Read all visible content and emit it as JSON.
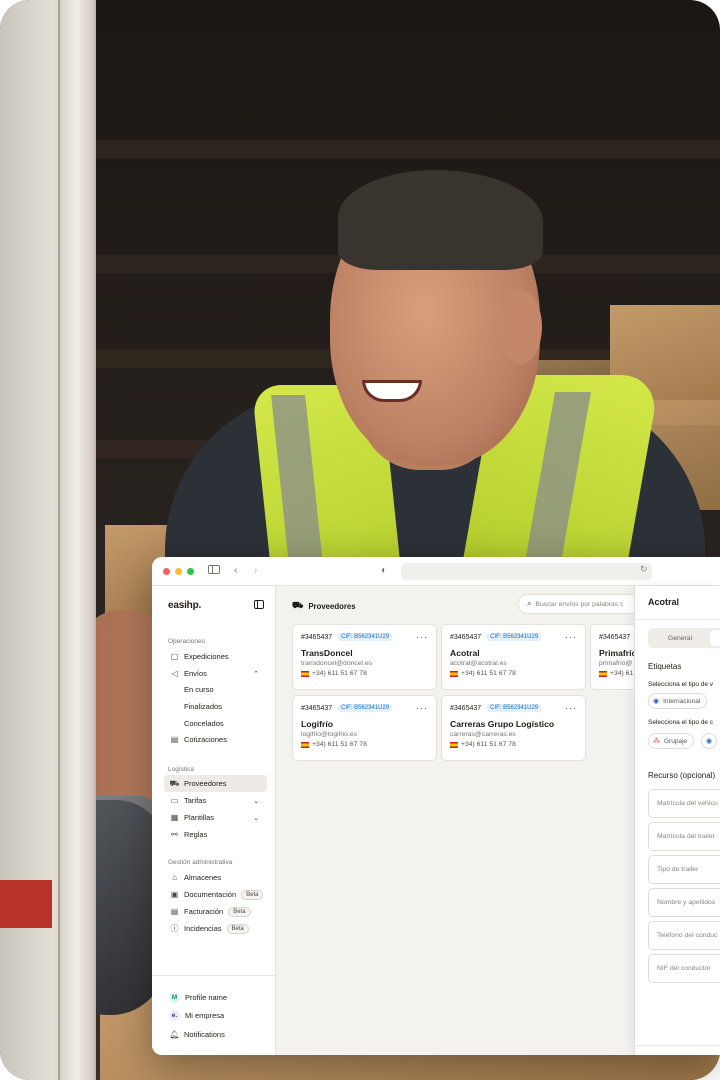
{
  "window": {
    "title": ""
  },
  "sidebar": {
    "logo": "easihp.",
    "sections": {
      "operaciones": "Operaciones",
      "logistica": "Logística",
      "gestion": "Gestión administrativa"
    },
    "items": {
      "expediciones": "Expediciones",
      "envios": "Envíos",
      "en_curso": "En curso",
      "finalizados": "Finalizados",
      "concelados": "Concelados",
      "cotizaciones": "Cotizaciones",
      "proveedores": "Proveedores",
      "tarifas": "Tarifas",
      "plantillas": "Plantillas",
      "reglas": "Reglas",
      "almacenes": "Almacenes",
      "documentacion": "Documentación",
      "facturacion": "Facturación",
      "incidencias": "Incidencias"
    },
    "badge_beta": "Beta",
    "footer": {
      "profile": "Profile name",
      "profile_initial": "M",
      "company": "Mi empresa",
      "company_initial": "e.",
      "notifications": "Notifications"
    }
  },
  "main": {
    "title": "Proveedores",
    "search_placeholder": "Buscar envíos por palabras c",
    "cards": [
      {
        "id": "#3465437",
        "cif": "CIF: B562341U29",
        "name": "TransDoncel",
        "email": "transdoncel@doncel.es",
        "phone": "+34) 611 51 67 78"
      },
      {
        "id": "#3465437",
        "cif": "CIF: B562341U29",
        "name": "Acotral",
        "email": "acotral@acotral.es",
        "phone": "+34) 611 51 67 78"
      },
      {
        "id": "#3465437",
        "cif": "CIF: B562341U29",
        "name": "Primafrío",
        "email": "primafrio@",
        "phone": "+34) 61"
      },
      {
        "id": "#3465437",
        "cif": "CIF: B562341U29",
        "name": "Logifrío",
        "email": "logifrio@logifrio.es",
        "phone": "+34) 611 51 67 78"
      },
      {
        "id": "#3465437",
        "cif": "CIF: B562341U29",
        "name": "Carreras Grupo Logístico",
        "email": "carreras@carreras.es",
        "phone": "+34) 611 51 67 78"
      }
    ]
  },
  "detail": {
    "title": "Acotral",
    "tab_general": "General",
    "etiquetas": "Etiquetas",
    "label_tipo_v": "Selecciona el tipo de v",
    "chip_internacional": "Internacional",
    "label_tipo_c": "Selecciona el tipo de c",
    "chip_grupaje": "Grupaje",
    "recurso": "Recurso (opcional)",
    "fields": {
      "matricula_vehiculo": "Matrícula del vehícu",
      "matricula_trailer": "Matrícula del trailer",
      "tipo_trailer": "Tipo de trailer",
      "nombre": "Nombre y apellidos",
      "telefono": "Teléfono del conduc",
      "nif": "NIF del conductor"
    }
  },
  "colors": {
    "accent_cif": "#1c6fb8",
    "vest": "#d4e84a",
    "dot_red": "#ff5f57",
    "dot_yellow": "#febc2e",
    "dot_green": "#28c840"
  }
}
